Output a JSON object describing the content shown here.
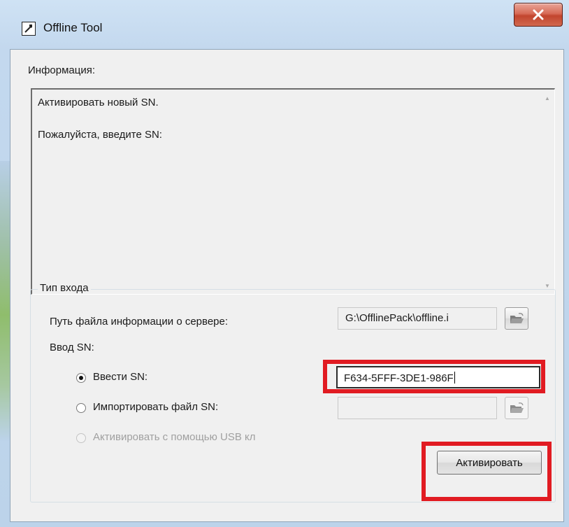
{
  "window": {
    "title": "Offline Tool",
    "close_glyph": "X",
    "icon": "app-tool-icon"
  },
  "info": {
    "label": "Информация:",
    "lines": [
      "Активировать новый SN.",
      "Пожалуйста, введите SN:"
    ]
  },
  "login_type": {
    "group_title": "Тип входа",
    "server_path_label": "Путь файла информации о сервере:",
    "server_path_value": "G:\\OfflinePack\\offline.i",
    "sn_input_label": "Ввод SN:",
    "options": {
      "enter_sn": {
        "label": "Ввести SN:",
        "selected": true
      },
      "import_file": {
        "label": "Импортировать файл SN:",
        "selected": false
      },
      "usb_key": {
        "label": "Активировать с помощью USB кл",
        "selected": false,
        "disabled": true
      }
    },
    "sn_value": "F634-5FFF-3DE1-986F",
    "import_value": ""
  },
  "buttons": {
    "activate": "Активировать",
    "browse_icon": "folder-open-icon"
  },
  "colors": {
    "highlight": "#e11b22",
    "close_button": "#c7452f",
    "window_background": "#f0f0f0"
  }
}
